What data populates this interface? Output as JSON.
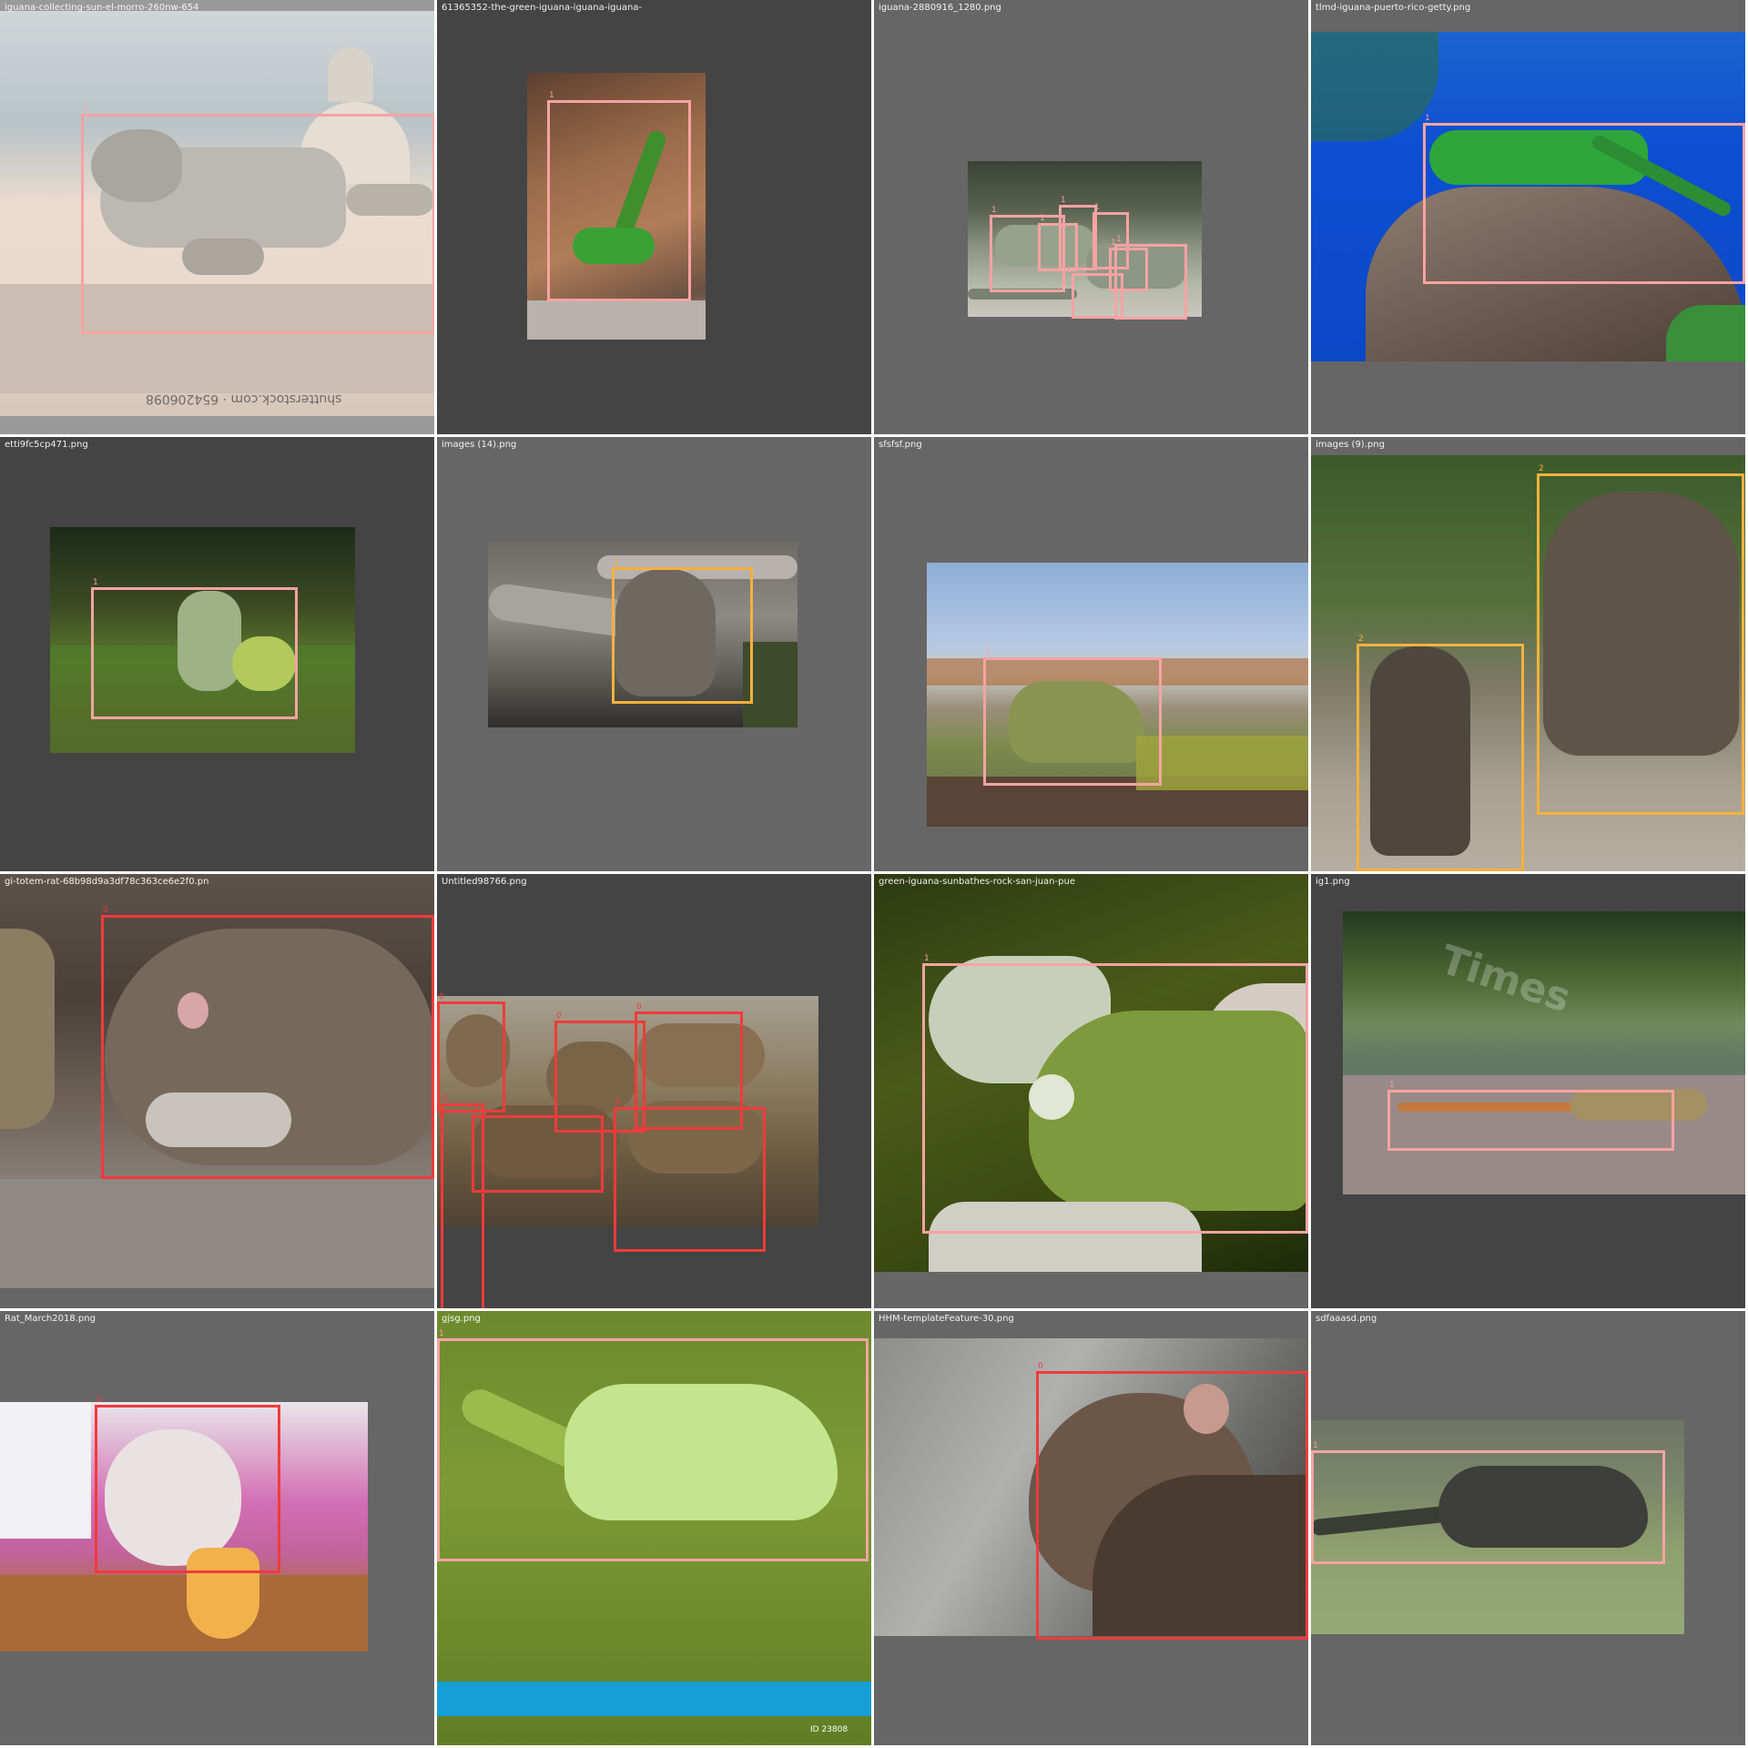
{
  "colors": {
    "canvas_background": "#ffffff",
    "letterbox_dark": "#444444",
    "letterbox_mid": "#666666",
    "filename_text": "#ffffff",
    "class_colors": {
      "0": "#ef3b3b",
      "1": "#f7a3a3",
      "2": "#f5b13c"
    }
  },
  "tiles": [
    {
      "filename": "iguana-collecting-sun-el-morro-260nw-654",
      "letterbox": "#999999",
      "subject": "grey iguana on stone wall by the sea",
      "watermark": "shutterstock.com · 654206098",
      "boxes": [
        {
          "class_id": "1"
        }
      ]
    },
    {
      "filename": "61365352-the-green-iguana-iguana-iguana-",
      "letterbox": "#444444",
      "subject": "small green iguana on brown rock",
      "boxes": [
        {
          "class_id": "1"
        }
      ]
    },
    {
      "filename": "iguana-2880916_1280.png",
      "letterbox": "#666666",
      "subject": "group of grey iguanas",
      "boxes": [
        {
          "class_id": "1"
        },
        {
          "class_id": "1"
        },
        {
          "class_id": "1"
        },
        {
          "class_id": "1"
        },
        {
          "class_id": "1"
        },
        {
          "class_id": "1"
        },
        {
          "class_id": "1"
        }
      ]
    },
    {
      "filename": "tlmd-iguana-puerto-rico-getty.png",
      "letterbox": "#666666",
      "subject": "green iguana on a boulder with blue water",
      "boxes": [
        {
          "class_id": "1"
        }
      ]
    },
    {
      "filename": "etti9fc5cp471.png",
      "letterbox": "#444444",
      "subject": "iguana in green grass",
      "boxes": [
        {
          "class_id": "1"
        }
      ]
    },
    {
      "filename": "images (14).png",
      "letterbox": "#666666",
      "subject": "mongoose among logs",
      "boxes": [
        {
          "class_id": "2"
        }
      ]
    },
    {
      "filename": "sfsfsf.png",
      "letterbox": "#666666",
      "subject": "iguana on hillside with town behind",
      "boxes": [
        {
          "class_id": "1"
        }
      ]
    },
    {
      "filename": "images (9).png",
      "letterbox": "#666666",
      "subject": "two mongooses on sand",
      "boxes": [
        {
          "class_id": "2"
        },
        {
          "class_id": "2"
        }
      ]
    },
    {
      "filename": "gi-totem-rat-68b98d9a3df78c363ce6e2f0.pn",
      "letterbox": "#666666",
      "subject": "brown rat eating on the floor",
      "boxes": [
        {
          "class_id": "0"
        }
      ]
    },
    {
      "filename": "Untitled98766.png",
      "letterbox": "#444444",
      "subject": "many rats in a cage",
      "boxes": [
        {
          "class_id": "0"
        },
        {
          "class_id": "0"
        },
        {
          "class_id": "0"
        },
        {
          "class_id": "0"
        },
        {
          "class_id": "0"
        },
        {
          "class_id": "0"
        },
        {
          "class_id": "0"
        }
      ]
    },
    {
      "filename": "green-iguana-sunbathes-rock-san-juan-pue",
      "letterbox": "#666666",
      "subject": "close-up of green iguana",
      "boxes": [
        {
          "class_id": "1"
        }
      ]
    },
    {
      "filename": "ig1.png",
      "letterbox": "#444444",
      "subject": "striped iguana by a river",
      "watermark": "Times",
      "boxes": [
        {
          "class_id": "1"
        }
      ]
    },
    {
      "filename": "Rat_March2018.png",
      "letterbox": "#666666",
      "subject": "white and grey pet rat with cheese",
      "boxes": [
        {
          "class_id": "0"
        }
      ]
    },
    {
      "filename": "gjsg.png",
      "letterbox": "#666666",
      "subject": "pale green iguana on grass",
      "watermark": "ID 23808",
      "boxes": [
        {
          "class_id": "1"
        }
      ]
    },
    {
      "filename": "HHM-templateFeature-30.png",
      "letterbox": "#666666",
      "subject": "close-up of a brown rat",
      "boxes": [
        {
          "class_id": "0"
        }
      ]
    },
    {
      "filename": "sdfaaasd.png",
      "letterbox": "#666666",
      "subject": "dark iguana walking on lawn",
      "boxes": [
        {
          "class_id": "1"
        }
      ]
    }
  ]
}
